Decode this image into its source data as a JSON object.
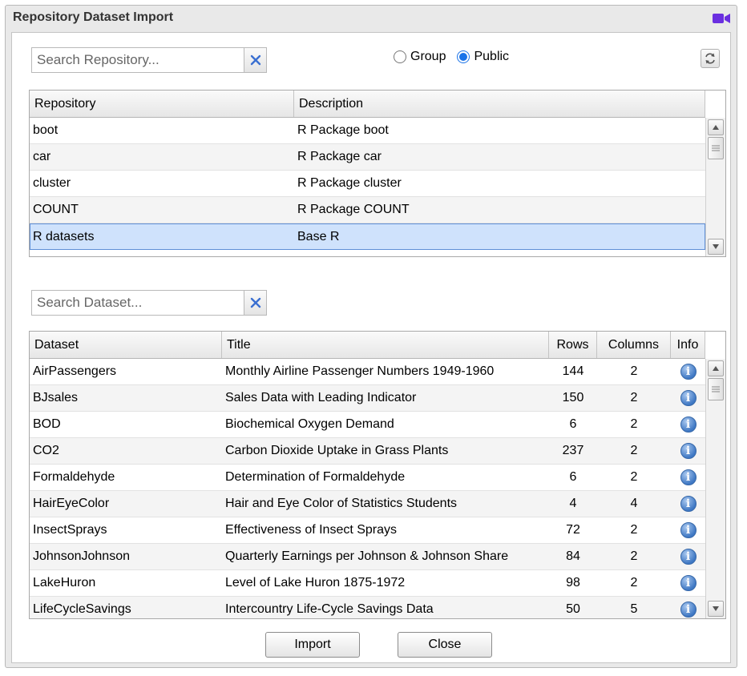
{
  "window": {
    "title": "Repository Dataset Import"
  },
  "repo_search": {
    "placeholder": "Search Repository..."
  },
  "scope": {
    "options": [
      "Group",
      "Public"
    ],
    "selected": "Public"
  },
  "repo_table": {
    "columns": [
      "Repository",
      "Description"
    ],
    "rows": [
      {
        "name": "boot",
        "description": "R Package boot"
      },
      {
        "name": "car",
        "description": "R Package car"
      },
      {
        "name": "cluster",
        "description": "R Package cluster"
      },
      {
        "name": "COUNT",
        "description": "R Package COUNT"
      },
      {
        "name": "R datasets",
        "description": "Base R"
      }
    ],
    "selected_index": 4
  },
  "dataset_search": {
    "placeholder": "Search Dataset..."
  },
  "dataset_table": {
    "columns": [
      "Dataset",
      "Title",
      "Rows",
      "Columns",
      "Info"
    ],
    "rows": [
      {
        "dataset": "AirPassengers",
        "title": "Monthly Airline Passenger Numbers 1949-1960",
        "rows": "144",
        "columns": "2"
      },
      {
        "dataset": "BJsales",
        "title": "Sales Data with Leading Indicator",
        "rows": "150",
        "columns": "2"
      },
      {
        "dataset": "BOD",
        "title": "Biochemical Oxygen Demand",
        "rows": "6",
        "columns": "2"
      },
      {
        "dataset": "CO2",
        "title": "Carbon Dioxide Uptake in Grass Plants",
        "rows": "237",
        "columns": "2"
      },
      {
        "dataset": "Formaldehyde",
        "title": "Determination of Formaldehyde",
        "rows": "6",
        "columns": "2"
      },
      {
        "dataset": "HairEyeColor",
        "title": "Hair and Eye Color of Statistics Students",
        "rows": "4",
        "columns": "4"
      },
      {
        "dataset": "InsectSprays",
        "title": "Effectiveness of Insect Sprays",
        "rows": "72",
        "columns": "2"
      },
      {
        "dataset": "JohnsonJohnson",
        "title": "Quarterly Earnings per Johnson & Johnson Share",
        "rows": "84",
        "columns": "2"
      },
      {
        "dataset": "LakeHuron",
        "title": "Level of Lake Huron 1875-1972",
        "rows": "98",
        "columns": "2"
      },
      {
        "dataset": "LifeCycleSavings",
        "title": "Intercountry Life-Cycle Savings Data",
        "rows": "50",
        "columns": "5"
      }
    ]
  },
  "buttons": {
    "import": "Import",
    "close": "Close"
  },
  "icons": {
    "title": "video-camera-icon",
    "clear": "clear-x-icon",
    "refresh": "refresh-icon",
    "info": "info-icon",
    "info_glyph": "i"
  },
  "colors": {
    "accent": "#1a73e8",
    "selection": "#cfe2fc",
    "camera": "#6a2fe0",
    "info": "#3f78c4"
  }
}
